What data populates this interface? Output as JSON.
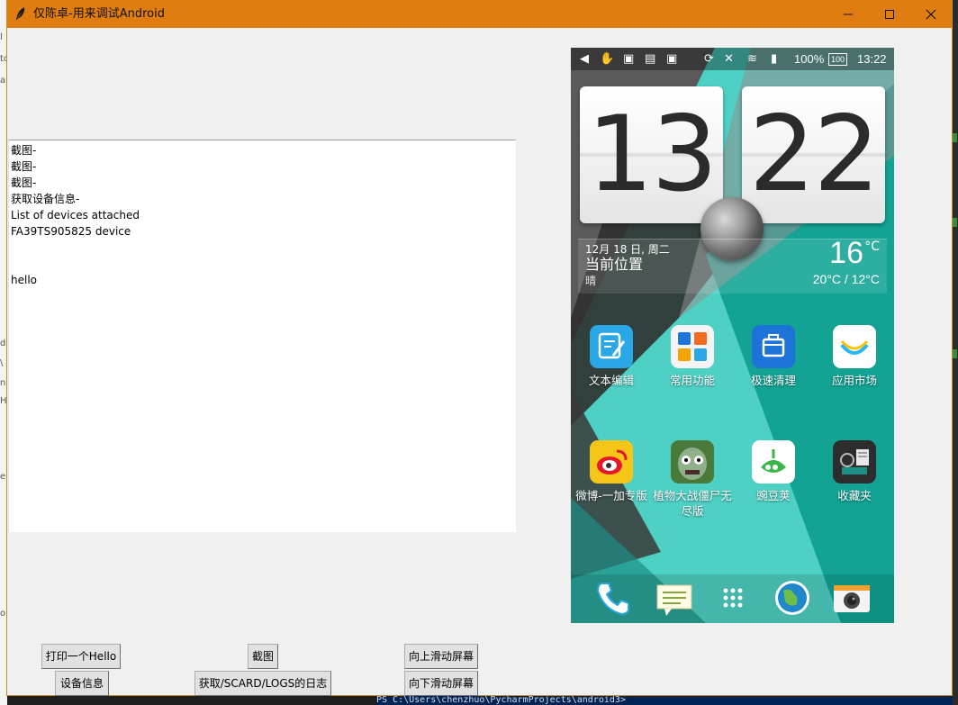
{
  "window": {
    "title": "仅陈卓-用来调试Android",
    "controls": {
      "minimize": "—",
      "maximize": "☐",
      "close": "✕"
    }
  },
  "background_fragments": {
    "left": [
      "l",
      "to",
      "a",
      "d",
      "\\",
      "n",
      "H",
      "e",
      "o"
    ],
    "terminal": "PS C:\\Users\\chenzhuo\\PycharmProjects\\android3>"
  },
  "log": {
    "lines": [
      "截图-",
      "截图-",
      "截图-",
      "获取设备信息-",
      "List of devices attached",
      "FA39TS905825 device",
      "",
      "",
      "hello"
    ]
  },
  "buttons": {
    "print_hello": "打印一个Hello",
    "screenshot": "截图",
    "scroll_up": "向上滑动屏幕",
    "device_info": "设备信息",
    "get_logs": "获取/SCARD/LOGS的日志",
    "scroll_down": "向下滑动屏幕"
  },
  "phone": {
    "status": {
      "battery_pct": "100%",
      "battery_badge": "100",
      "time": "13:22"
    },
    "clock": {
      "hour": "13",
      "minute": "22"
    },
    "weather": {
      "date": "12月 18 日, 周二",
      "location": "当前位置",
      "condition": "晴",
      "temp": "16",
      "unit": "°C",
      "range": "20°C / 12°C"
    },
    "apps_row1": [
      "文本编辑",
      "常用功能",
      "极速清理",
      "应用市场"
    ],
    "apps_row2": [
      "微博-一加专版",
      "植物大战僵尸无尽版",
      "豌豆荚",
      "收藏夹"
    ],
    "dock": [
      "phone-icon",
      "messages-icon",
      "app-drawer-icon",
      "browser-icon",
      "camera-icon"
    ]
  },
  "colors": {
    "titlebar": "#e07d10",
    "phone_teal": "#4ed0c4",
    "phone_dark_teal": "#12a394"
  }
}
